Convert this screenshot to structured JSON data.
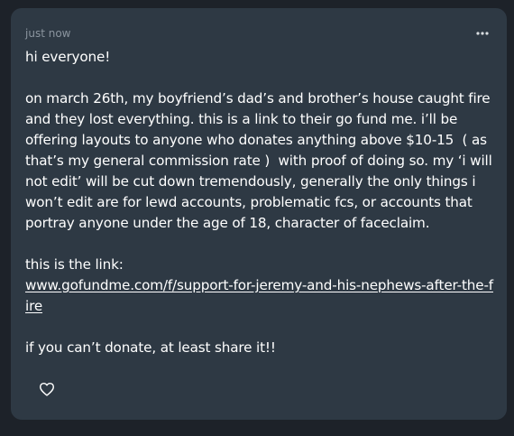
{
  "post": {
    "timestamp": "just now",
    "more_icon": "more-dots-icon",
    "greeting": "hi everyone!",
    "paragraph": "on march 26th, my boyfriend’s dad’s and brother’s house caught fire and they lost everything. this is a link to their go fund me. i’ll be offering layouts to anyone who donates anything above $10-15 ﻿ ( as that’s my general commission rate ) ﻿ with proof of doing so. my ‘i will not edit’ will be cut down tremendously, generally the only things i won’t edit are for lewd accounts, problematic fcs, or accounts that portray anyone under the age of 18, character of faceclaim.",
    "link_intro": "this is the link:",
    "link_text": "www.gofundme.com/f/support-for-jeremy-and-his-nephews-after-the-fire",
    "closing": "if you can’t donate, at least share it!!",
    "like_icon": "heart-icon"
  },
  "colors": {
    "page_background": "#1d2229",
    "card_background": "#2e3944",
    "text": "#ffffff",
    "muted_text": "#8b959f"
  }
}
